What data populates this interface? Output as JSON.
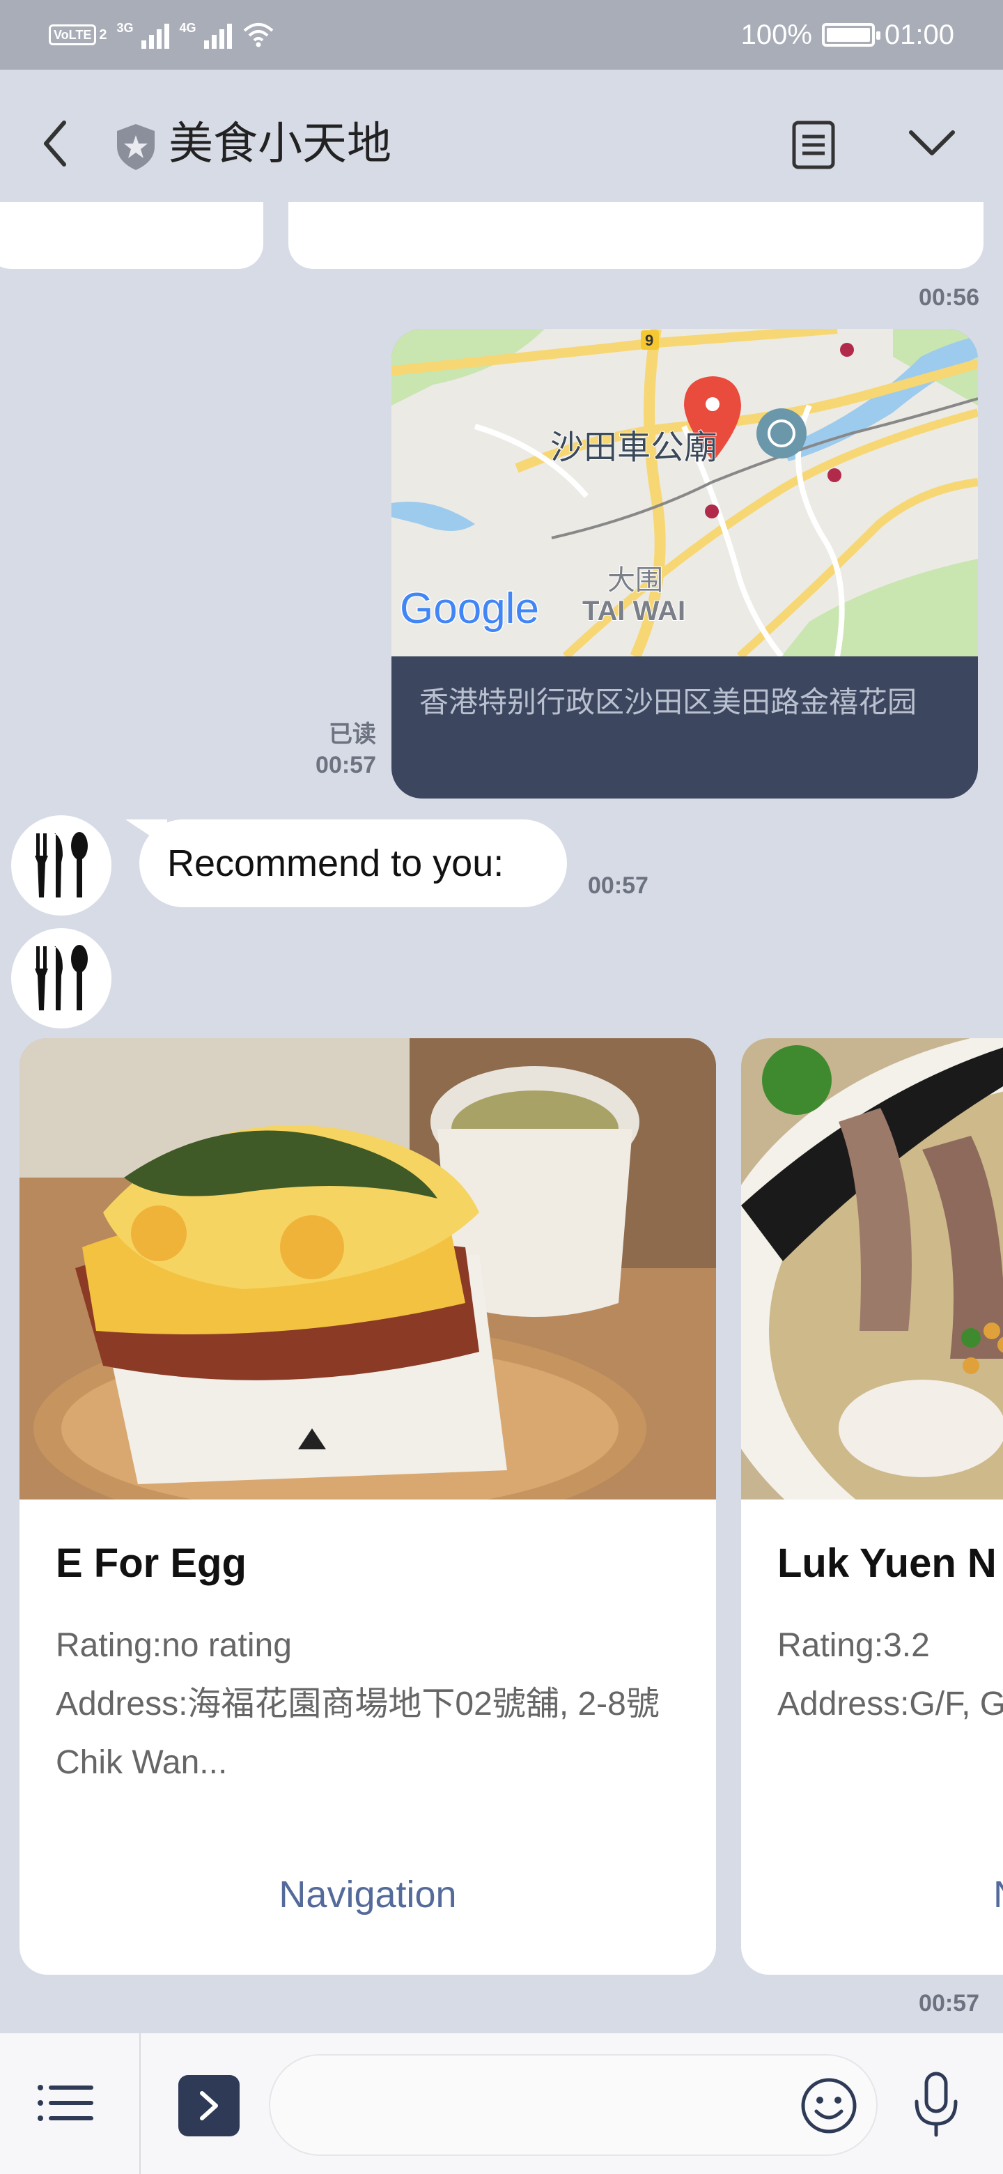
{
  "status_bar": {
    "volte": "VoLTE",
    "sim_index": "2",
    "network_1": "3G",
    "network_2": "4G",
    "battery_percent": "100%",
    "clock": "01:00"
  },
  "header": {
    "title": "美食小天地",
    "icons": [
      "back-arrow-icon",
      "shield-star-icon",
      "notes-icon",
      "chevron-down-icon"
    ]
  },
  "messages": {
    "prev_time": "00:56",
    "location": {
      "map_labels": {
        "route_number": "9",
        "place_name": "沙田車公廟",
        "district_cn": "大围",
        "district_en": "TAI WAI",
        "brand": "Google"
      },
      "address": "香港特别行政区沙田区美田路金禧花园",
      "read_status": "已读",
      "time": "00:57"
    },
    "recommend": {
      "text": "Recommend to you:",
      "time": "00:57"
    },
    "carousel_time": "00:57"
  },
  "cards": [
    {
      "name": "E For Egg",
      "rating": "Rating:no rating",
      "address": "Address:海福花園商場地下02號舖, 2-8號 Chik Wan...",
      "action": "Navigation"
    },
    {
      "name": "Luk Yuen N",
      "rating": "Rating:3.2",
      "address": "Address:G/F, Ga...",
      "action": "N"
    }
  ],
  "input_bar": {
    "placeholder": ""
  },
  "colors": {
    "background": "#d7dbe6",
    "status_bar": "#a9adb8",
    "map_footer": "#3c475f",
    "link": "#536a9a"
  }
}
